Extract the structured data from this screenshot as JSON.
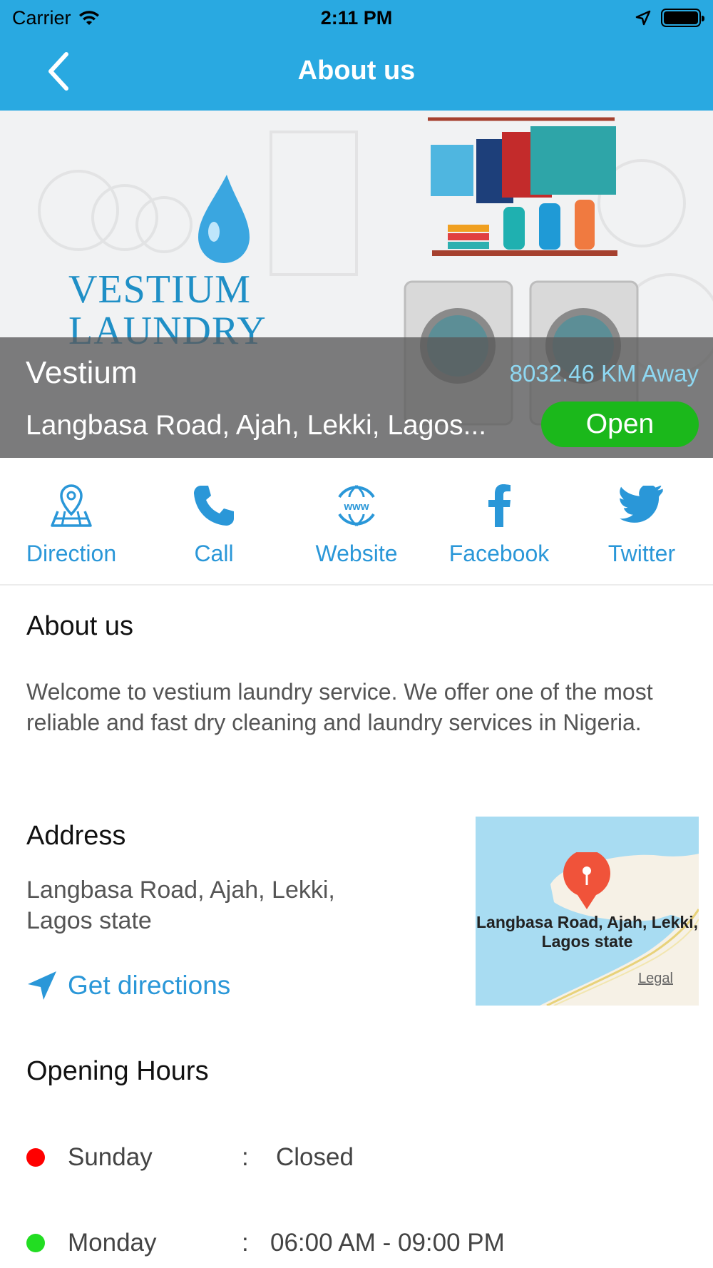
{
  "status_bar": {
    "carrier": "Carrier",
    "time": "2:11 PM"
  },
  "nav": {
    "title": "About us",
    "back_icon": "chevron-left-icon"
  },
  "banner": {
    "brand_line1": "VESTIUM",
    "brand_line2": "LAUNDRY",
    "name": "Vestium",
    "distance": "8032.46 KM Away",
    "address": "Langbasa Road, Ajah, Lekki, Lagos...",
    "status": "Open",
    "status_color": "#1bb81b"
  },
  "actions": [
    {
      "label": "Direction",
      "icon": "map-pin-icon"
    },
    {
      "label": "Call",
      "icon": "phone-icon"
    },
    {
      "label": "Website",
      "icon": "www-globe-icon"
    },
    {
      "label": "Facebook",
      "icon": "facebook-icon"
    },
    {
      "label": "Twitter",
      "icon": "twitter-icon"
    }
  ],
  "about": {
    "title": "About us",
    "text": "Welcome to vestium laundry service. We offer one of the most reliable and fast dry cleaning and laundry services in Nigeria."
  },
  "address": {
    "title": "Address",
    "text": "Langbasa Road, Ajah, Lekki, Lagos state",
    "directions_label": "Get directions",
    "map_label": "Langbasa Road, Ajah, Lekki, Lagos state",
    "map_legal": "Legal"
  },
  "opening_hours": {
    "title": "Opening Hours",
    "rows": [
      {
        "day": "Sunday",
        "sep": ":",
        "hours": "Closed",
        "status_color": "#ff0000"
      },
      {
        "day": "Monday",
        "sep": ":",
        "hours": "06:00 AM - 09:00 PM",
        "status_color": "#22dd22"
      }
    ]
  },
  "colors": {
    "accent": "#29a9e1",
    "link": "#2a97d8"
  }
}
